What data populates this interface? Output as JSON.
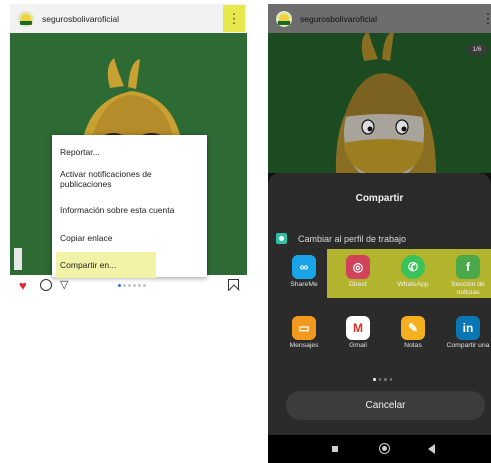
{
  "account": "segurosbolivaroficial",
  "menu": {
    "items": [
      "Reportar...",
      "Activar notificaciones de publicaciones",
      "Información sobre esta cuenta",
      "Copiar enlace",
      "Compartir en..."
    ]
  },
  "carousel_counter": "1/6",
  "share": {
    "title": "Compartir",
    "profile_switch": "Cambiar al perfil de trabajo",
    "apps": [
      {
        "label": "ShareMe",
        "icon": "shareme-icon",
        "color": "#1aa4e8"
      },
      {
        "label": "Direct",
        "icon": "instagram-icon",
        "color": "#d0435b"
      },
      {
        "label": "WhatsApp",
        "icon": "whatsapp-icon",
        "color": "#3ac25b"
      },
      {
        "label": "Sección de noticias",
        "icon": "facebook-icon",
        "color": "#4ba84b"
      },
      {
        "label": "Mensajes",
        "icon": "messages-icon",
        "color": "#f39a1e"
      },
      {
        "label": "Gmail",
        "icon": "gmail-icon",
        "color": "#ffffff"
      },
      {
        "label": "Notas",
        "icon": "notes-icon",
        "color": "#f5b020"
      },
      {
        "label": "Compartir una",
        "icon": "linkedin-icon",
        "color": "#0a77b5"
      }
    ],
    "cancel": "Cancelar"
  },
  "colors": {
    "highlight": "#e6e84d",
    "like_red": "#e02a38",
    "post_green": "#2e6b34"
  }
}
